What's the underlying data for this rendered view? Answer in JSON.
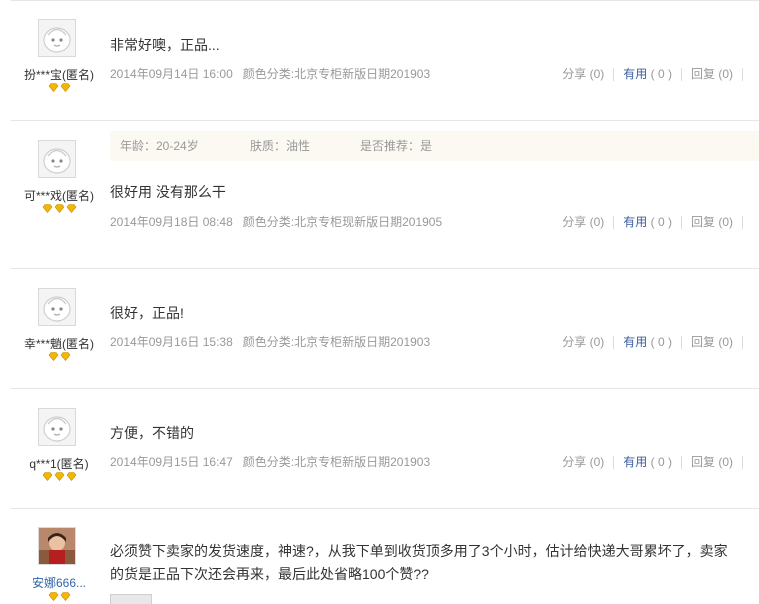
{
  "reviews": [
    {
      "user": "扮***宝(匿名)",
      "rank": 2,
      "content": "非常好噢，正品...",
      "date": "2014年09月14日 16:00",
      "spec": "颜色分类:北京专柜新版日期201903",
      "share": "分享 (0)",
      "useful_label": "有用",
      "useful_count": "( 0 )",
      "reply": "回复 (0)"
    },
    {
      "user": "可***戏(匿名)",
      "rank": 3,
      "attrs": {
        "age": "年龄：20-24岁",
        "skin": "肤质：油性",
        "recommend": "是否推荐：是"
      },
      "content": "很好用 没有那么干",
      "date": "2014年09月18日 08:48",
      "spec": "颜色分类:北京专柜现新版日期201905",
      "share": "分享 (0)",
      "useful_label": "有用",
      "useful_count": "( 0 )",
      "reply": "回复 (0)"
    },
    {
      "user": "幸***魈(匿名)",
      "rank": 2,
      "content": "很好，正品!",
      "date": "2014年09月16日 15:38",
      "spec": "颜色分类:北京专柜新版日期201903",
      "share": "分享 (0)",
      "useful_label": "有用",
      "useful_count": "( 0 )",
      "reply": "回复 (0)"
    },
    {
      "user": "q***1(匿名)",
      "rank": 3,
      "content": "方便，不错的",
      "date": "2014年09月15日 16:47",
      "spec": "颜色分类:北京专柜新版日期201903",
      "share": "分享 (0)",
      "useful_label": "有用",
      "useful_count": "( 0 )",
      "reply": "回复 (0)"
    },
    {
      "user": "安娜666...",
      "rank": 2,
      "content_line1": "必须赞下卖家的发货速度，神速?，从我下单到收货顶多用了3个小时，估计给快递大哥累坏了，卖家",
      "content_line2": "的货是正品下次还会再来，最后此处省略100个赞??"
    }
  ],
  "colors": {
    "useful_link": "#3d5f9e",
    "meta_text": "#999999",
    "rank_gem": "#f2b705",
    "attr_bg": "#fcf8f2"
  }
}
